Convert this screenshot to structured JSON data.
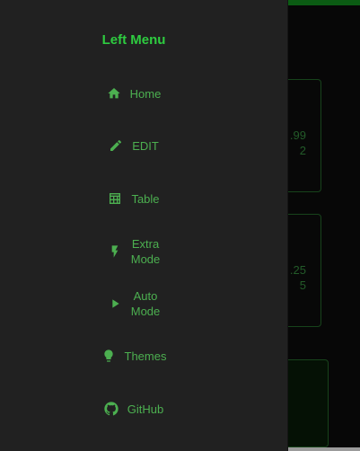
{
  "drawer": {
    "title": "Left Menu",
    "items": [
      {
        "label": "Home",
        "icon": "home-icon"
      },
      {
        "label": "EDIT",
        "icon": "pencil-icon"
      },
      {
        "label": "Table",
        "icon": "table-icon"
      },
      {
        "label": "Extra\nMode",
        "line1": "Extra",
        "line2": "Mode",
        "icon": "bolt-icon"
      },
      {
        "label": "Auto\nMode",
        "line1": "Auto",
        "line2": "Mode",
        "icon": "play-icon"
      },
      {
        "label": "Themes",
        "icon": "lightbulb-icon"
      },
      {
        "label": "GitHub",
        "icon": "github-icon"
      }
    ]
  },
  "background": {
    "card1": {
      "line1": ".99",
      "line2": "2"
    },
    "card2": {
      "line1": ".25",
      "line2": "5"
    }
  },
  "colors": {
    "accent": "#2ecc40",
    "menu_text": "#4caf50",
    "drawer_bg": "#212121",
    "app_bg": "#000000",
    "topbar": "#0f7a1a"
  }
}
